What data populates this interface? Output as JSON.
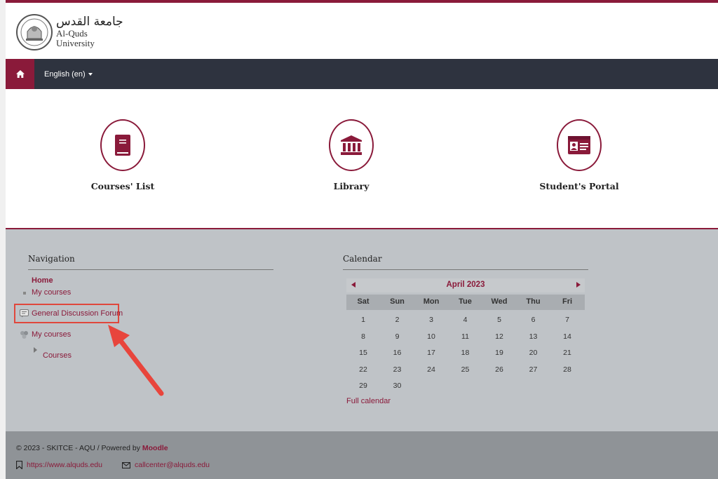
{
  "brand": {
    "arabic_name": "جامعة القدس",
    "english_name": "Al-Quds University",
    "accent_color": "#8a1a3a"
  },
  "navbar": {
    "home_icon": "home-icon",
    "language": "English (en)"
  },
  "tiles": [
    {
      "label": "Courses' List",
      "icon": "book-icon"
    },
    {
      "label": "Library",
      "icon": "library-building-icon"
    },
    {
      "label": "Student's Portal",
      "icon": "id-card-icon"
    }
  ],
  "navigation": {
    "title": "Navigation",
    "home": "Home",
    "my_courses_1": "My courses",
    "forum": "General Discussion Forum",
    "my_courses_2": "My courses",
    "courses": "Courses"
  },
  "calendar": {
    "title": "Calendar",
    "month": "April 2023",
    "days": [
      "Sat",
      "Sun",
      "Mon",
      "Tue",
      "Wed",
      "Thu",
      "Fri"
    ],
    "weeks": [
      [
        "1",
        "2",
        "3",
        "4",
        "5",
        "6",
        "7"
      ],
      [
        "8",
        "9",
        "10",
        "11",
        "12",
        "13",
        "14"
      ],
      [
        "15",
        "16",
        "17",
        "18",
        "19",
        "20",
        "21"
      ],
      [
        "22",
        "23",
        "24",
        "25",
        "26",
        "27",
        "28"
      ],
      [
        "29",
        "30",
        "",
        "",
        "",
        "",
        ""
      ]
    ],
    "full_calendar": "Full calendar"
  },
  "footer": {
    "copyright": "© 2023 - SKITCE - AQU / Powered by ",
    "powered_by": "Moodle",
    "website": "https://www.alquds.edu",
    "email": "callcenter@alquds.edu"
  }
}
